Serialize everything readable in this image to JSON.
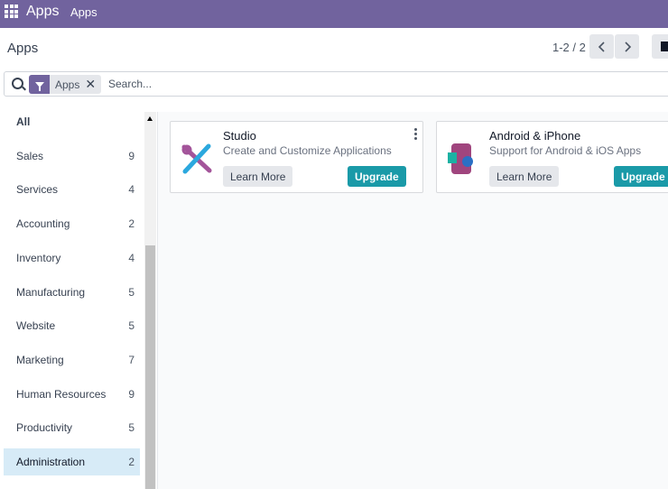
{
  "topbar": {
    "app_title": "Apps",
    "menu_apps": "Apps"
  },
  "control": {
    "breadcrumb": "Apps",
    "pager": "1-2 / 2",
    "prev_icon": "chevron-left-icon",
    "next_icon": "chevron-right-icon"
  },
  "search": {
    "facet_label": "Apps",
    "placeholder": "Search..."
  },
  "sidebar": {
    "items": [
      {
        "label": "All",
        "count": ""
      },
      {
        "label": "Sales",
        "count": "9"
      },
      {
        "label": "Services",
        "count": "4"
      },
      {
        "label": "Accounting",
        "count": "2"
      },
      {
        "label": "Inventory",
        "count": "4"
      },
      {
        "label": "Manufacturing",
        "count": "5"
      },
      {
        "label": "Website",
        "count": "5"
      },
      {
        "label": "Marketing",
        "count": "7"
      },
      {
        "label": "Human Resources",
        "count": "9"
      },
      {
        "label": "Productivity",
        "count": "5"
      },
      {
        "label": "Administration",
        "count": "2"
      }
    ],
    "active_index": 10
  },
  "apps": [
    {
      "name": "Studio",
      "description": "Create and Customize Applications",
      "learn_more": "Learn More",
      "upgrade": "Upgrade"
    },
    {
      "name": "Android & iPhone",
      "description": "Support for Android & iOS Apps",
      "learn_more": "Learn More",
      "upgrade": "Upgrade"
    }
  ],
  "colors": {
    "brand": "#71639e",
    "upgrade": "#1a9aa8",
    "active_item": "#d7ebf7"
  }
}
